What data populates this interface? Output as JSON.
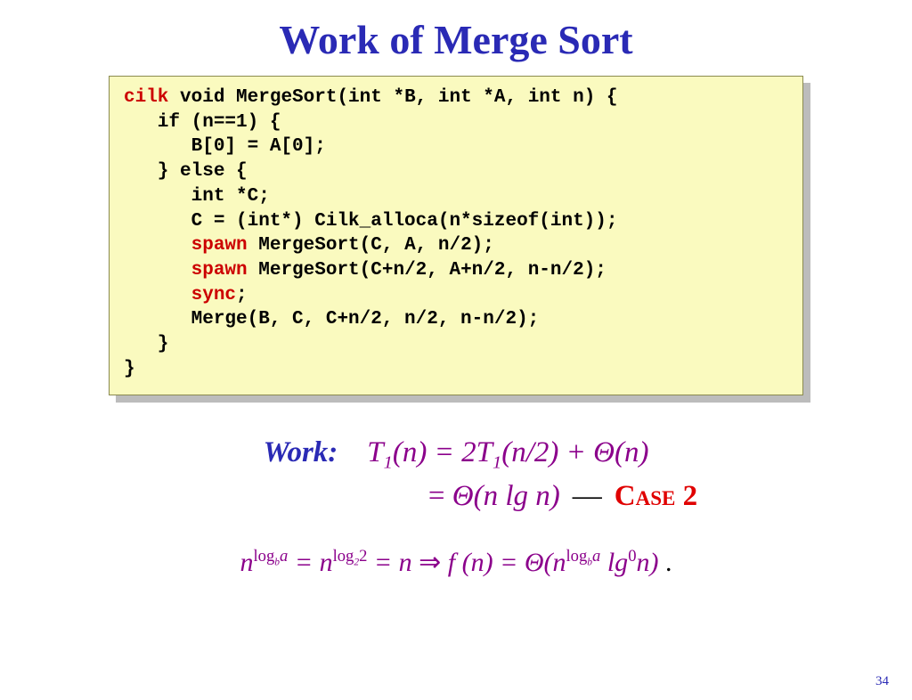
{
  "title": "Work of Merge Sort",
  "code": {
    "l1a": "cilk",
    "l1b": " void MergeSort(int *B, int *A, int n) {",
    "l2": "   if (n==1) {",
    "l3": "      B[0] = A[0];",
    "l4": "   } else { ",
    "l5": "      int *C;",
    "l6": "      C = (int*) Cilk_alloca(n*sizeof(int));",
    "l7a": "      ",
    "l7k": "spawn",
    "l7b": " MergeSort(C, A, n/2);",
    "l8a": "      ",
    "l8k": "spawn",
    "l8b": " MergeSort(C+n/2, A+n/2, n-n/2);",
    "l9a": "      ",
    "l9k": "sync",
    "l9b": ";",
    "l10": "      Merge(B, C, C+n/2, n/2, n-n/2);",
    "l11": "   }",
    "l12": "}"
  },
  "work": {
    "label": "Work:",
    "eq1_lhs": "T",
    "eq1_rest": "(n) =  2T",
    "eq1_tail": "(n/2) + Θ(n)",
    "eq2_indent_eq": "=",
    "eq2_body": " Θ(n lg n)",
    "dash": "—",
    "case": "Case 2"
  },
  "formula": {
    "t1": "n",
    "exp1a": "log",
    "exp1b": "b",
    "exp1c": "a",
    "t2": " = n",
    "exp2a": "log",
    "exp2b": "2",
    "exp2c": "2",
    "t3": " = n ",
    "arrow": "⇒",
    "t4": " f (n) = Θ(n",
    "exp3a": "log",
    "exp3b": "b",
    "exp3c": "a",
    "t5": " lg",
    "exp4": "0",
    "t6": "n)",
    "dot": " ."
  },
  "page": "34"
}
